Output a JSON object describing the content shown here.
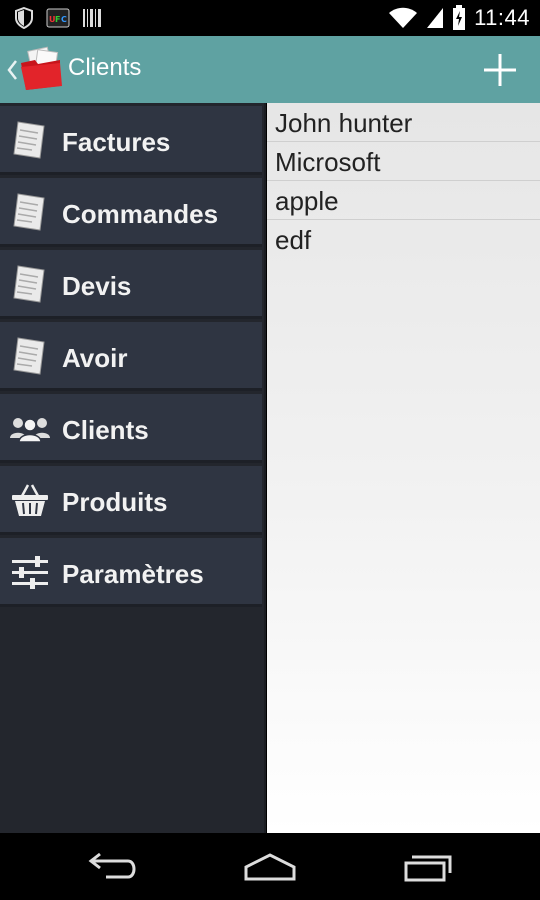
{
  "status_bar": {
    "time": "11:44",
    "icons": [
      "shield-icon",
      "ufc-app-icon",
      "barcode-icon",
      "wifi-icon",
      "signal-icon",
      "battery-charging-icon"
    ]
  },
  "action_bar": {
    "title": "Clients",
    "add_icon": "plus-icon",
    "back_icon": "chevron-left-icon",
    "logo_icon": "red-folder-icon"
  },
  "drawer": {
    "items": [
      {
        "label": "Factures",
        "icon": "document-icon"
      },
      {
        "label": "Commandes",
        "icon": "document-icon"
      },
      {
        "label": "Devis",
        "icon": "document-icon"
      },
      {
        "label": "Avoir",
        "icon": "document-icon"
      },
      {
        "label": "Clients",
        "icon": "users-icon"
      },
      {
        "label": "Produits",
        "icon": "basket-icon"
      },
      {
        "label": "Paramètres",
        "icon": "sliders-icon"
      }
    ]
  },
  "clients": {
    "items": [
      "John hunter",
      "Microsoft",
      "apple",
      "edf"
    ]
  },
  "nav_bar": {
    "buttons": [
      "back-icon",
      "home-icon",
      "recent-apps-icon"
    ]
  },
  "colors": {
    "action_bar": "#5fa2a2",
    "drawer_item": "#2f3542",
    "drawer_bg": "#23262d"
  }
}
